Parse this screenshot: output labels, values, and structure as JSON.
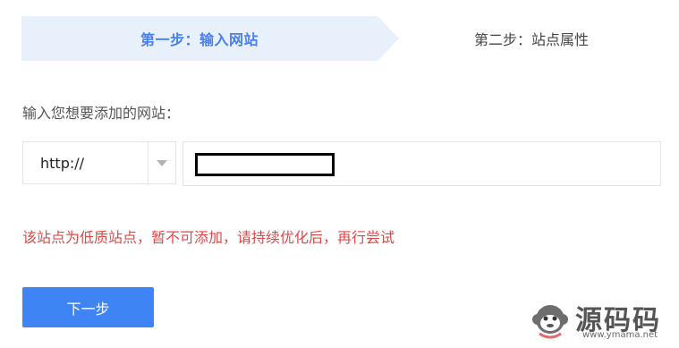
{
  "steps": {
    "active_label": "第一步：输入网站",
    "next_label": "第二步：站点属性"
  },
  "form": {
    "prompt": "输入您想要添加的网站：",
    "protocol_value": "http://",
    "url_value": "",
    "error_message": "该站点为低质站点，暂不可添加，请持续优化后，再行尝试",
    "next_button_label": "下一步"
  },
  "watermark": {
    "brand": "源码码",
    "url": "www.ymama.net"
  },
  "colors": {
    "accent": "#3f84f5",
    "step_active_bg": "#e8f0fc",
    "step_active_text": "#4a7ff0",
    "error": "#e04848",
    "border": "#e3e3e3"
  },
  "icons": {
    "protocol_caret": "chevron-down-icon",
    "watermark_logo": "monkey-logo-icon"
  }
}
